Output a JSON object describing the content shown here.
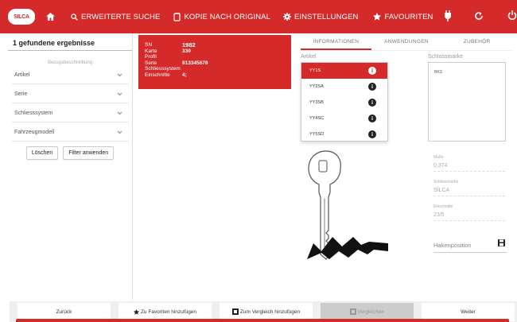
{
  "nav": {
    "items": [
      {
        "label": "ERWEITERTE SUCHE",
        "icon": "search-icon"
      },
      {
        "label": "KOPIE NACH ORIGINAL",
        "icon": "document-copy-icon"
      },
      {
        "label": "EINSTELLUNGEN",
        "icon": "gear-icon"
      },
      {
        "label": "FAVOURITEN",
        "icon": "star-icon"
      }
    ],
    "logo_text": "SILCA"
  },
  "left_panel": {
    "results_title": "1 gefundene ergebnisse",
    "section_caption": "Bezugsbeschreibung",
    "filters": [
      "Artikel",
      "Serie",
      "Schliesssystem",
      "Fahrzeugmodell"
    ],
    "clear_label": "Löschen",
    "apply_label": "Filter anwenden"
  },
  "result_card": {
    "rows": [
      {
        "k": "SN",
        "v": "1982"
      },
      {
        "k": "Karte",
        "v": "330"
      },
      {
        "k": "Profil",
        "v": ""
      },
      {
        "k": "Serie",
        "v": "813345678"
      },
      {
        "k": "Schliesssystem",
        "v": ""
      },
      {
        "k": "Einschnitte",
        "v": "4;"
      }
    ]
  },
  "tabs": [
    "INFORMATIONEN",
    "ANWENDUNGEN",
    "ZUBEHÖR"
  ],
  "article_label": "Artikel",
  "articles": [
    "YY1S",
    "YY2SA",
    "YY3SB",
    "YY4SC",
    "YY5SD"
  ],
  "lock_label": "Schlossmarke",
  "lock_value": "BKS",
  "right_fields": [
    {
      "label": "Maße",
      "value": "0,374"
    },
    {
      "label": "Schlossmarke",
      "value": "SILCA"
    },
    {
      "label": "Einschnitte",
      "value": "23/5"
    }
  ],
  "hakenposition_label": "Hakenposition",
  "bottom": {
    "back": "Zurück",
    "add_fav": "Zu Favoriten hinzufügen",
    "add_compare": "Zum Vergleich hinzufügen",
    "compare": "Vergleichen",
    "next": "Weiter"
  },
  "colors": {
    "accent": "#d42a2a"
  }
}
